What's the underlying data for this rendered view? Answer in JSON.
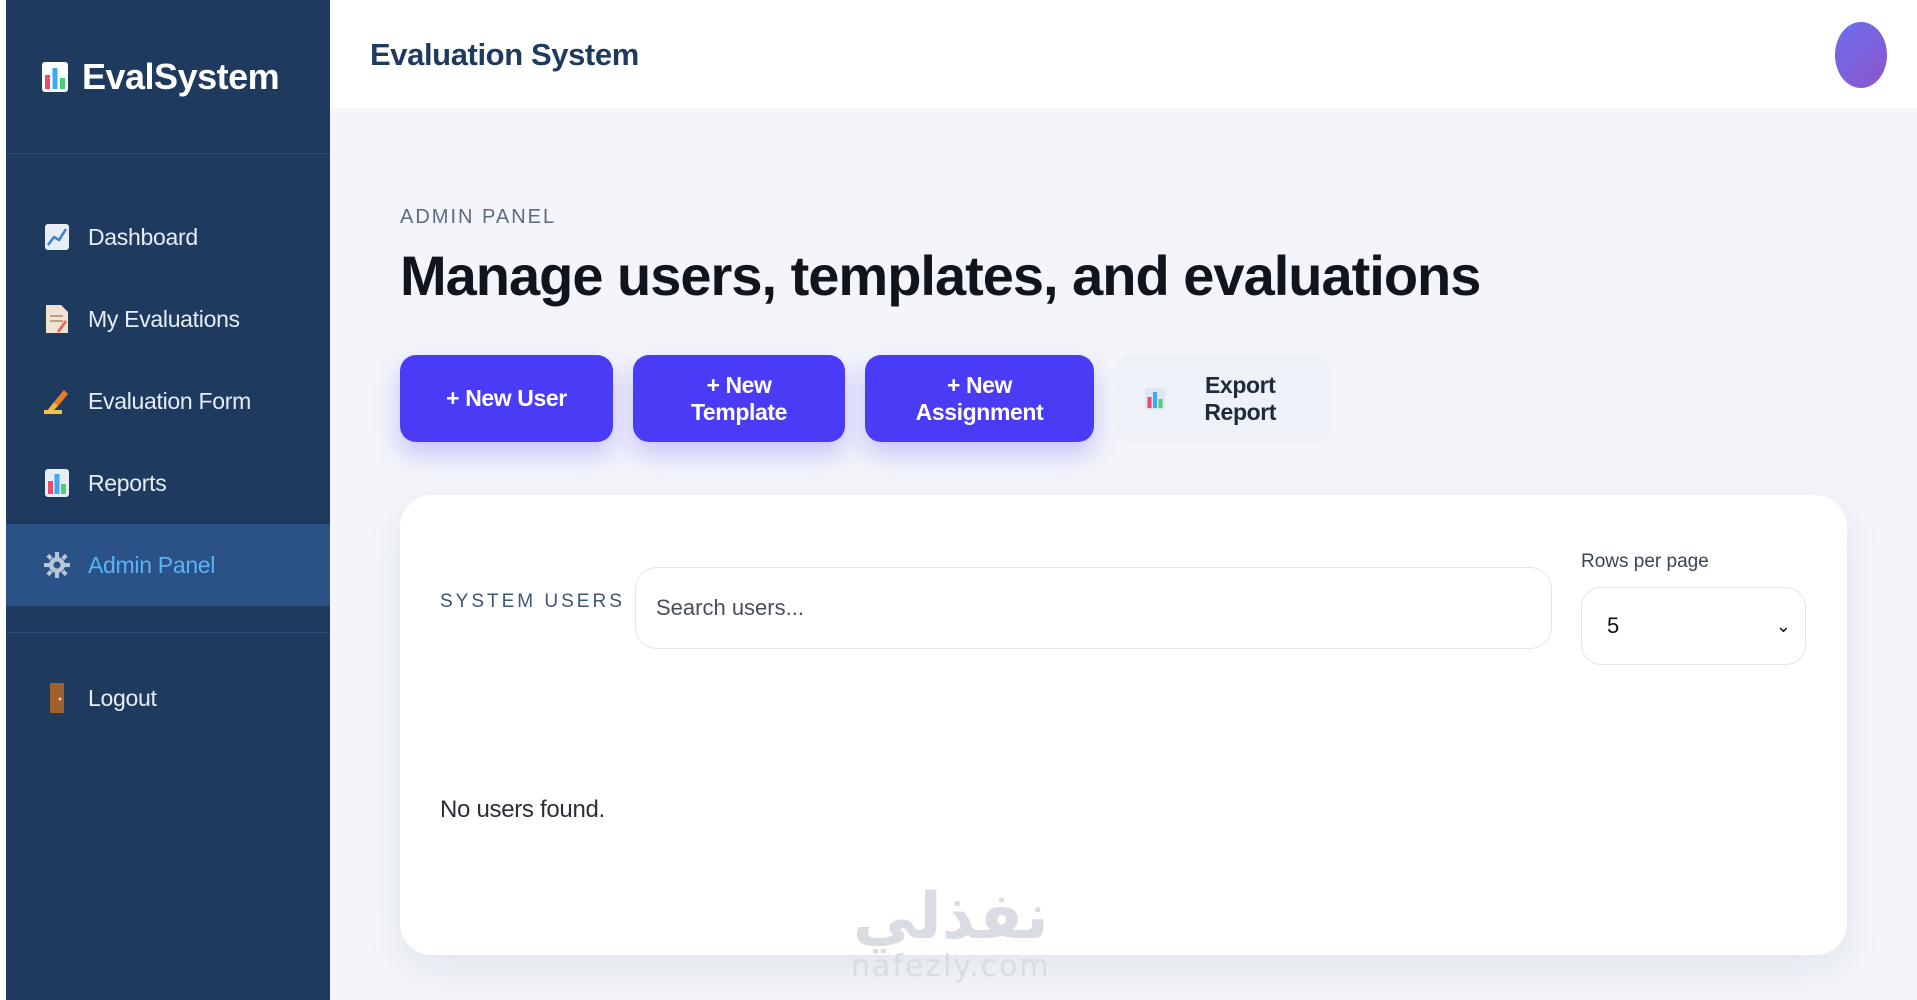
{
  "brand": {
    "name": "EvalSystem",
    "icon": "bar-chart-icon"
  },
  "sidebar": {
    "items": [
      {
        "label": "Dashboard",
        "icon": "line-chart-icon",
        "active": false
      },
      {
        "label": "My Evaluations",
        "icon": "document-icon",
        "active": false
      },
      {
        "label": "Evaluation Form",
        "icon": "pen-icon",
        "active": false
      },
      {
        "label": "Reports",
        "icon": "bar-chart-icon",
        "active": false
      },
      {
        "label": "Admin Panel",
        "icon": "gear-icon",
        "active": true
      }
    ],
    "logout": {
      "label": "Logout",
      "icon": "door-icon"
    }
  },
  "header": {
    "title": "Evaluation System"
  },
  "page": {
    "eyebrow": "ADMIN PANEL",
    "title": "Manage users, templates, and evaluations"
  },
  "actions": {
    "new_user": "+ New User",
    "new_template": "+ New Template",
    "new_assignment": "+ New Assignment",
    "export_report": "Export Report"
  },
  "users": {
    "label": "SYSTEM USERS",
    "search_placeholder": "Search users...",
    "rows_label": "Rows per page",
    "rows_value": "5",
    "empty_message": "No users found."
  },
  "watermark": {
    "arabic": "نفذلي",
    "latin": "nafezly.com"
  },
  "colors": {
    "sidebar_bg": "#1e3a5f",
    "active_item_bg": "#2a5287",
    "active_item_text": "#5ab3f5",
    "primary_button": "#4a3cf6",
    "page_bg": "#f3f5fa"
  }
}
